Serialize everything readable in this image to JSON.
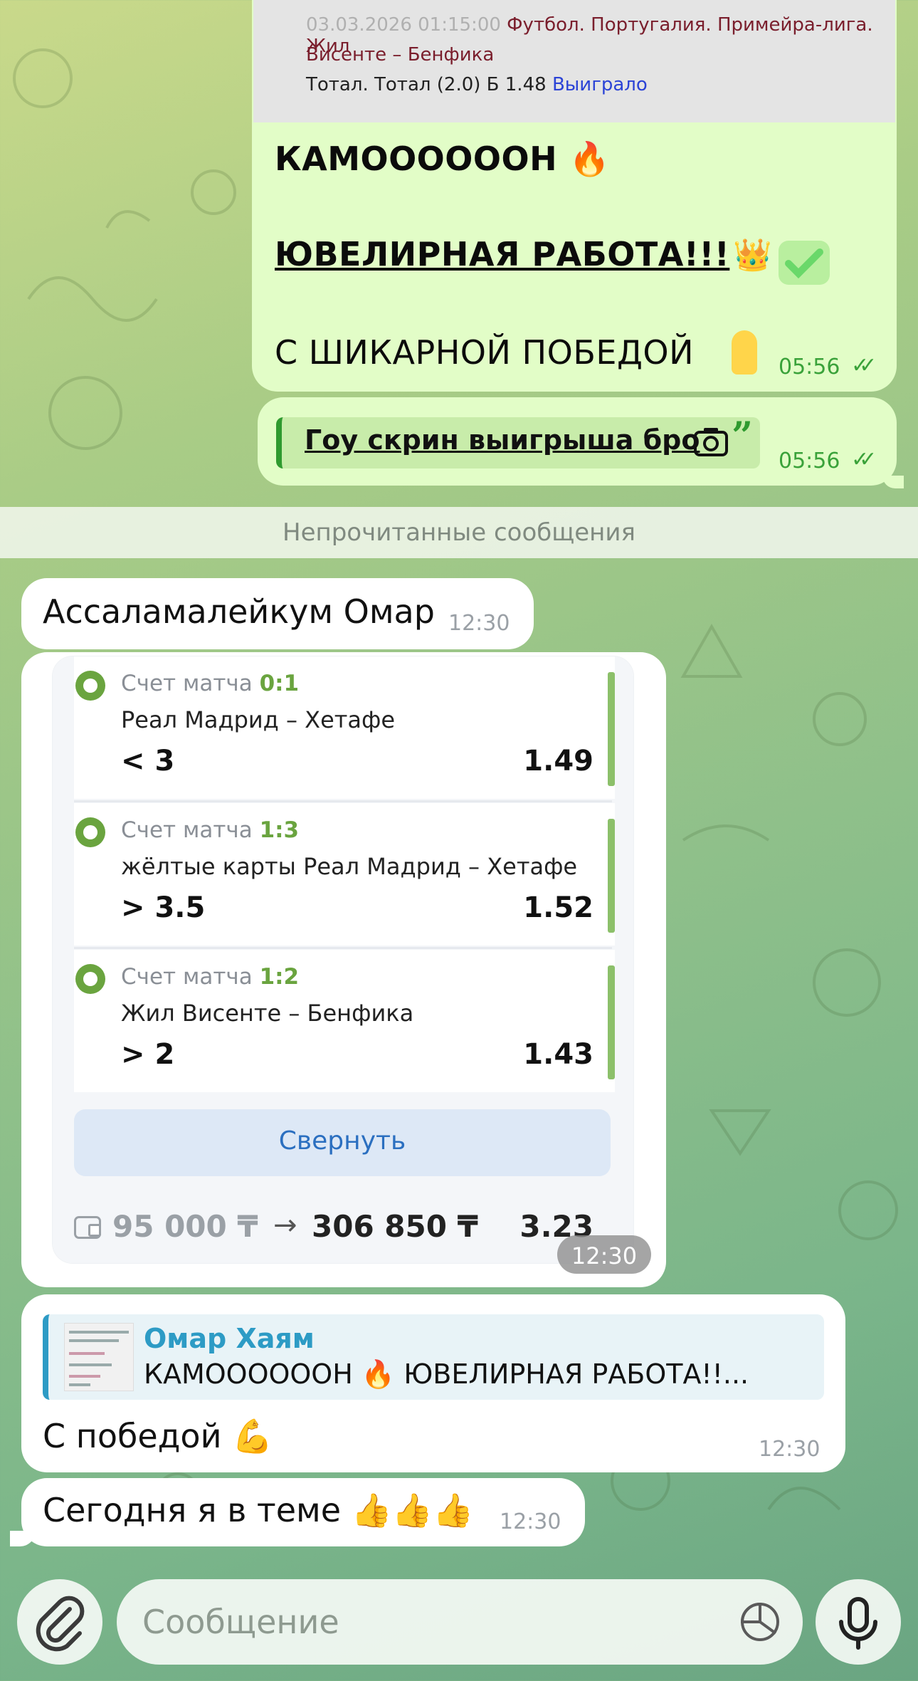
{
  "outgoing": {
    "bet_strip": {
      "date": "03.03.2026 01:15:00",
      "match_line1": "Футбол. Португалия. Примейра-лига. Жил",
      "match_line2": "Висенте – Бенфика",
      "bet_line": "Тотал. Тотал (2.0) Б 1.48",
      "result": "Выиграло"
    },
    "line1": "КАМООООООН 🔥",
    "line2": "ЮВЕЛИРНАЯ РАБОТА!!!",
    "line2_emoji": "👑",
    "line3": "С ШИКАРНОЙ ПОБЕДОЙ",
    "time": "05:56",
    "quote_text": "Гоу скрин выигрыша бро",
    "quote_time": "05:56"
  },
  "unread_label": "Непрочитанные сообщения",
  "incoming": {
    "greeting": "Ассаламалейкум Омар",
    "greeting_time": "12:30",
    "bets": [
      {
        "label": "Счет матча",
        "score": "0:1",
        "match": "Реал Мадрид – Хетафе",
        "pick": "< 3",
        "odds": "1.49"
      },
      {
        "label": "Счет матча",
        "score": "1:3",
        "match": "жёлтые карты Реал Мадрид – Хетафе",
        "pick": "> 3.5",
        "odds": "1.52"
      },
      {
        "label": "Счет матча",
        "score": "1:2",
        "match": "Жил Висенте – Бенфика",
        "pick": "> 2",
        "odds": "1.43"
      }
    ],
    "collapse_label": "Свернуть",
    "stake": "95 000 ₸",
    "arrow": "→",
    "payout": "306 850 ₸",
    "total_odds": "3.23",
    "card_time": "12:30",
    "reply_name": "Омар Хаям",
    "reply_snippet": "КАМООООООН 🔥 ЮВЕЛИРНАЯ РАБОТА!!...",
    "congrats": "С победой 💪",
    "congrats_time": "12:30",
    "last_msg": "Сегодня я в теме 👍👍👍",
    "last_time": "12:30"
  },
  "composer": {
    "placeholder": "Сообщение",
    "attach_icon": "paperclip-icon",
    "sticker_icon": "sticker-icon",
    "mic_icon": "microphone-icon"
  },
  "colors": {
    "outgoing_bubble": "#e2fdc7",
    "accent_green": "#3aa23a",
    "link_blue": "#2b6fc0"
  }
}
